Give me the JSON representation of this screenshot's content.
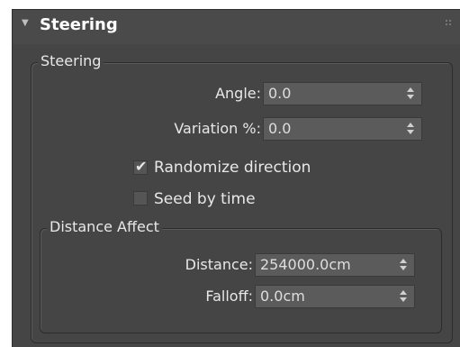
{
  "rollout": {
    "title": "Steering"
  },
  "steering_group": {
    "label": "Steering",
    "angle": {
      "label": "Angle:",
      "value": "0.0"
    },
    "variation": {
      "label": "Variation %:",
      "value": "0.0"
    },
    "randomize": {
      "label": "Randomize direction",
      "checked": true,
      "check_glyph": "✔"
    },
    "seed": {
      "label": "Seed by time",
      "checked": false
    }
  },
  "distance_group": {
    "label": "Distance Affect",
    "distance": {
      "label": "Distance:",
      "value": "254000.0cm"
    },
    "falloff": {
      "label": "Falloff:",
      "value": "0.0cm"
    }
  }
}
